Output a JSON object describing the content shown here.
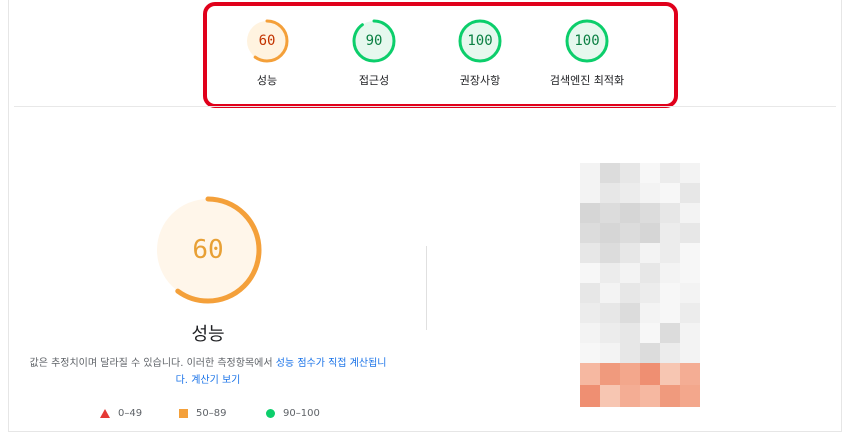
{
  "scores": [
    {
      "value": "60",
      "label": "성능",
      "color": "#f4a03a",
      "text_color": "#c33300",
      "bg": "#fff3e0",
      "fraction": 0.6
    },
    {
      "value": "90",
      "label": "접근성",
      "color": "#0cce6b",
      "text_color": "#0b8043",
      "bg": "#e6f8ee",
      "fraction": 0.9
    },
    {
      "value": "100",
      "label": "권장사항",
      "color": "#0cce6b",
      "text_color": "#0b8043",
      "bg": "#e6f8ee",
      "fraction": 1.0
    },
    {
      "value": "100",
      "label": "검색엔진 최적화",
      "color": "#0cce6b",
      "text_color": "#0b8043",
      "bg": "#e6f8ee",
      "fraction": 1.0
    }
  ],
  "main": {
    "score": "60",
    "score_fraction": 0.6,
    "title": "성능",
    "desc_text": "값은 추정치이며 달라질 수 있습니다. 이러한 측정항목에서 ",
    "desc_link": "성능 점수가 직접 계산됩니다.",
    "desc_link2": "계산기 보기"
  },
  "legend": [
    {
      "shape": "triangle",
      "range": "0–49",
      "color": "#e53935"
    },
    {
      "shape": "square",
      "range": "50–89",
      "color": "#f4a03a"
    },
    {
      "shape": "circle",
      "range": "90–100",
      "color": "#0cce6b"
    }
  ]
}
